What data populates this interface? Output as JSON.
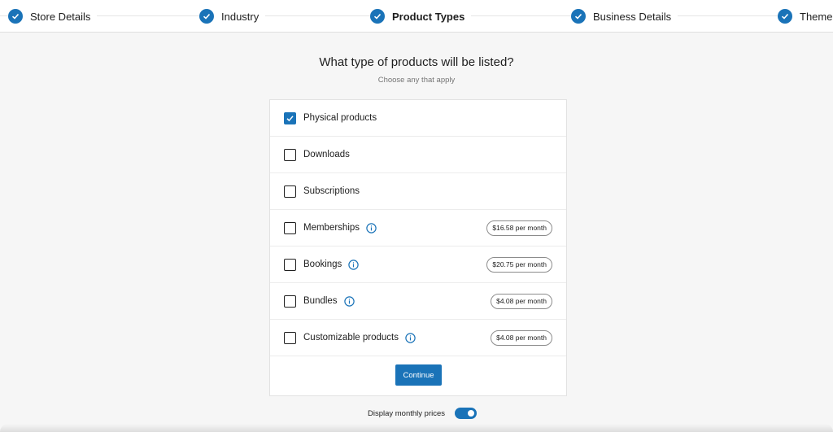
{
  "stepper": {
    "steps": [
      {
        "label": "Store Details",
        "active": false,
        "complete": true
      },
      {
        "label": "Industry",
        "active": false,
        "complete": true
      },
      {
        "label": "Product Types",
        "active": true,
        "complete": true
      },
      {
        "label": "Business Details",
        "active": false,
        "complete": true
      },
      {
        "label": "Theme",
        "active": false,
        "complete": true
      }
    ]
  },
  "main": {
    "heading": "What type of products will be listed?",
    "subheading": "Choose any that apply",
    "options": [
      {
        "label": "Physical products",
        "checked": true,
        "info": false,
        "price": ""
      },
      {
        "label": "Downloads",
        "checked": false,
        "info": false,
        "price": ""
      },
      {
        "label": "Subscriptions",
        "checked": false,
        "info": false,
        "price": ""
      },
      {
        "label": "Memberships",
        "checked": false,
        "info": true,
        "price": "$16.58 per month"
      },
      {
        "label": "Bookings",
        "checked": false,
        "info": true,
        "price": "$20.75 per month"
      },
      {
        "label": "Bundles",
        "checked": false,
        "info": true,
        "price": "$4.08 per month"
      },
      {
        "label": "Customizable products",
        "checked": false,
        "info": true,
        "price": "$4.08 per month"
      }
    ],
    "continue_label": "Continue"
  },
  "footer": {
    "toggle_label": "Display monthly prices",
    "toggle_on": true
  },
  "colors": {
    "accent": "#1a73b8",
    "background": "#f6f6f6"
  },
  "icons": {
    "step": "check-circle-icon",
    "info": "info-icon",
    "checkbox_checked": "checkmark-icon"
  }
}
